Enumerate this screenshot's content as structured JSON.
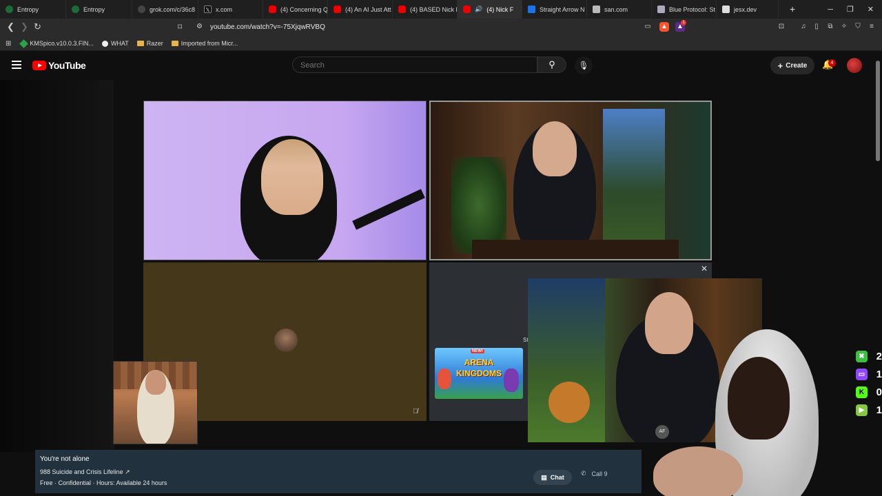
{
  "browser": {
    "tabs": [
      {
        "title": "Entropy",
        "favicon": "entropy-icon"
      },
      {
        "title": "Entropy",
        "favicon": "entropy-icon"
      },
      {
        "title": "grok.com/c/36c8",
        "favicon": "grok-icon"
      },
      {
        "title": "x.com",
        "favicon": "x-icon"
      },
      {
        "title": "(4) Concerning Q",
        "favicon": "youtube-icon"
      },
      {
        "title": "(4) An AI Just Att",
        "favicon": "youtube-icon"
      },
      {
        "title": "(4) BASED Nick F",
        "favicon": "youtube-icon"
      },
      {
        "title": "(4) Nick F",
        "favicon": "youtube-icon",
        "active": true
      },
      {
        "title": "Straight Arrow N",
        "favicon": "straight-arrow-icon"
      },
      {
        "title": "san.com",
        "favicon": "san-icon"
      },
      {
        "title": "Blue Protocol: St",
        "favicon": "blue-protocol-icon"
      },
      {
        "title": "jesx.dev",
        "favicon": "jesx-icon"
      }
    ],
    "url": "youtube.com/watch?v=-75XjqwRVBQ",
    "bookmarks": [
      {
        "label": "KMSpico.v10.0.3.FIN..."
      },
      {
        "label": "WHAT"
      },
      {
        "label": "Razer"
      },
      {
        "label": "Imported from Micr..."
      }
    ],
    "extension_badge": "1"
  },
  "youtube": {
    "logo_text": "YouTube",
    "search_placeholder": "Search",
    "create_label": "Create",
    "notification_count": "4"
  },
  "video": {
    "ad_line1": "ARENA",
    "ad_line2": "KINGDOMS",
    "ad_badge": "NEW!",
    "pip_badge": "AF",
    "fragment_text": "St"
  },
  "crisis_banner": {
    "title": "You're not alone",
    "line1": "988 Suicide and Crisis Lifeline",
    "line2": "Free · Confidential · Hours: Available 24 hours",
    "chat_label": "Chat",
    "call_label": "Call 9"
  },
  "stream_stats": [
    {
      "icon": "xbox-icon",
      "value": "2",
      "color": "#3fbf3f"
    },
    {
      "icon": "twitch-icon",
      "value": "1",
      "color": "#9146ff"
    },
    {
      "icon": "kick-icon",
      "value": "0",
      "color": "#53fc18"
    },
    {
      "icon": "rumble-icon",
      "value": "1",
      "color": "#85c742"
    }
  ]
}
